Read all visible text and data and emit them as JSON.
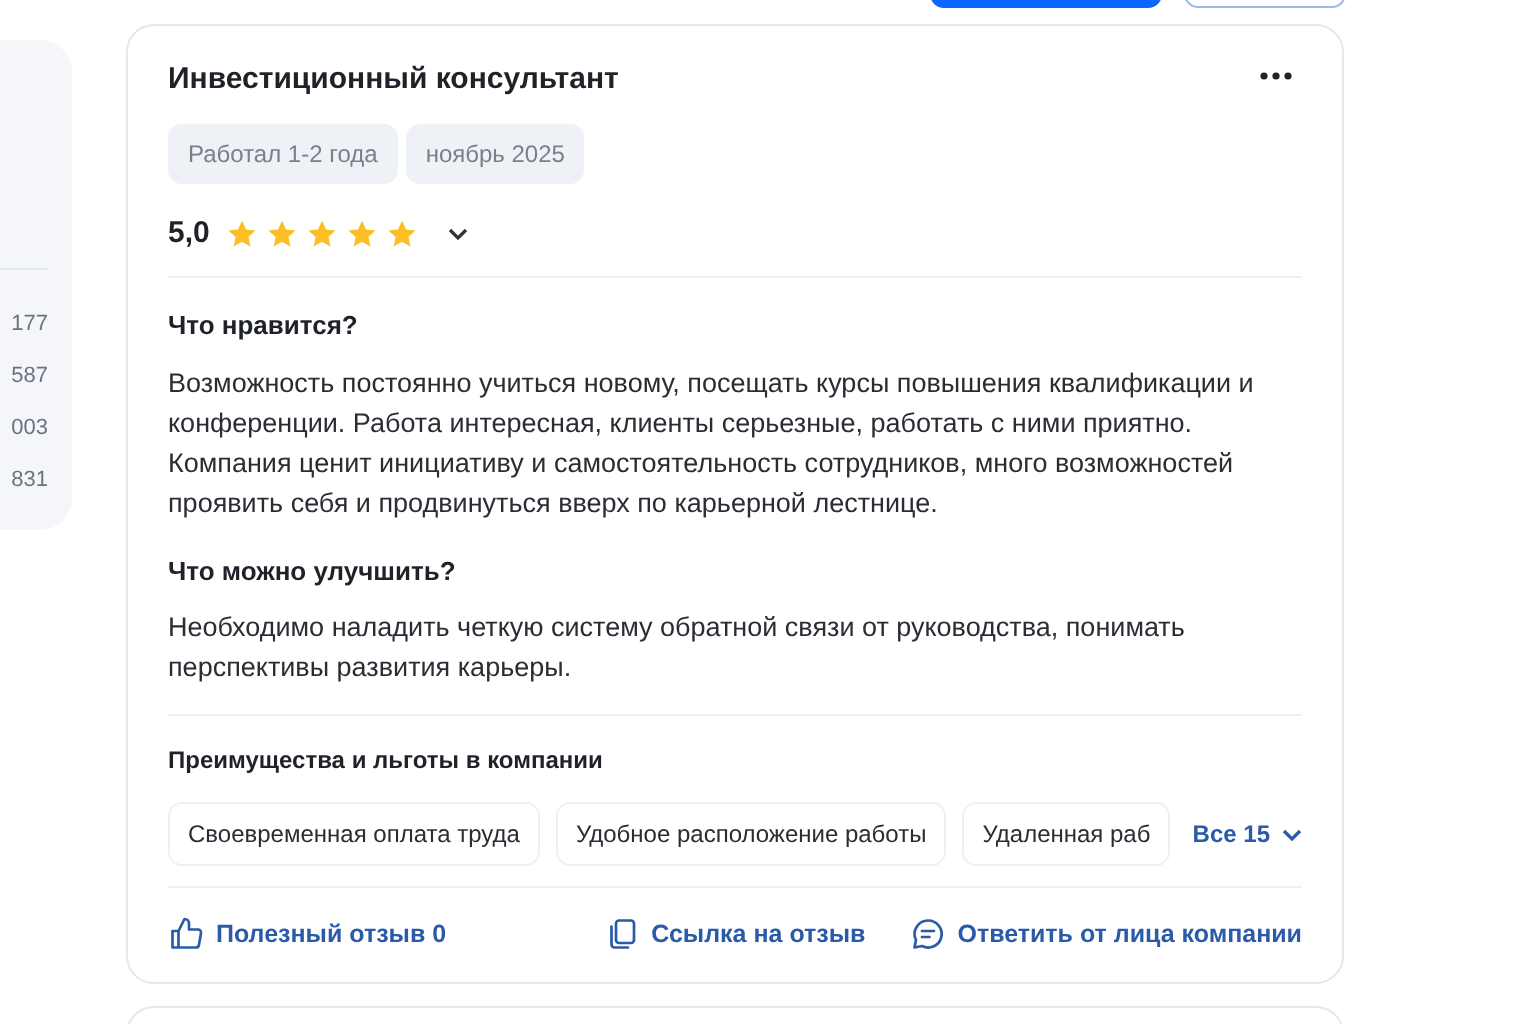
{
  "sidebar": {
    "values": [
      "177",
      "587",
      "003",
      "831"
    ]
  },
  "review": {
    "title": "Инвестиционный консультант",
    "tags": [
      "Работал 1-2 года",
      "ноябрь 2025"
    ],
    "rating": "5,0",
    "stars": 5,
    "sections": [
      {
        "heading": "Что нравится?",
        "text": "Возможность постоянно учиться новому, посещать курсы повышения квалификации и конференции. Работа интересная, клиенты серьезные, работать с ними приятно. Компания ценит инициативу и самостоятельность сотрудников, много возможностей проявить себя и продвинуться вверх по карьерной лестнице."
      },
      {
        "heading": "Что можно улучшить?",
        "text": "Необходимо наладить четкую систему обратной связи от руководства, понимать перспективы развития карьеры."
      }
    ],
    "benefits": {
      "heading": "Преимущества и льготы в компании",
      "items": [
        "Своевременная оплата труда",
        "Удобное расположение работы",
        "Удаленная раб"
      ],
      "more": "Все 15"
    },
    "actions": [
      {
        "kind": "like",
        "label": "Полезный отзыв 0"
      },
      {
        "kind": "link",
        "label": "Ссылка на отзыв"
      },
      {
        "kind": "reply",
        "label": "Ответить от лица компании"
      }
    ]
  }
}
